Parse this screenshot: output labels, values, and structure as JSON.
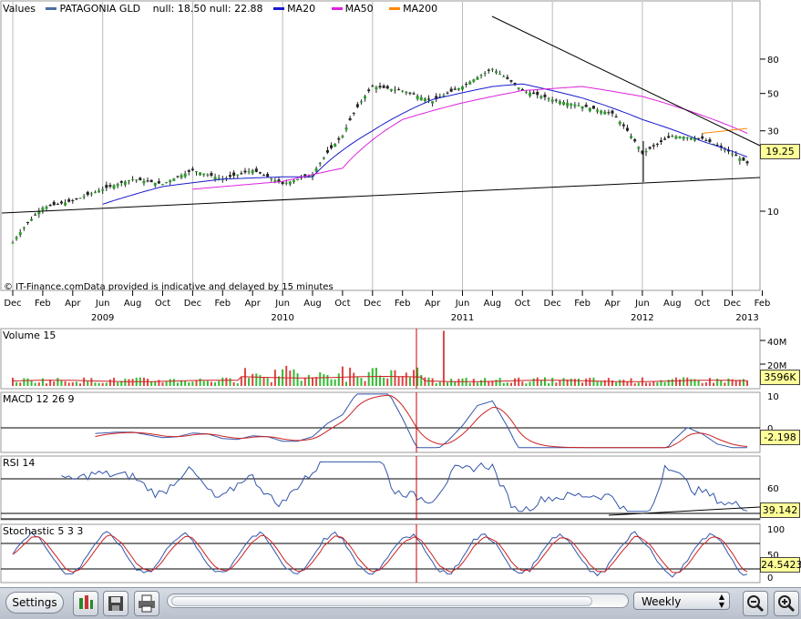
{
  "legend": {
    "values_label": "Values",
    "symbol": "PATAGONIA GLD",
    "null_info": "null: 18.50 null: 22.88",
    "ma20": "MA20",
    "ma50": "MA50",
    "ma200": "MA200",
    "colors": {
      "price": "#4a6fa5",
      "ma20": "#1a1acc",
      "ma50": "#dd22dd",
      "ma200": "#ff8800"
    }
  },
  "watermark": "© IT-Finance.comData provided is indicative and delayed by 15 minutes",
  "price_badge": "19.25",
  "x_axis": {
    "months": [
      "Dec",
      "Feb",
      "Apr",
      "Jun",
      "Aug",
      "Oct",
      "Dec",
      "Feb",
      "Apr",
      "Jun",
      "Aug",
      "Oct",
      "Dec",
      "Feb",
      "Apr",
      "Jun",
      "Aug",
      "Oct",
      "Dec",
      "Feb",
      "Apr",
      "Jun",
      "Aug",
      "Oct",
      "Dec",
      "Feb"
    ],
    "years": [
      "2009",
      "2010",
      "2011",
      "2012",
      "2013"
    ]
  },
  "volume_pane": {
    "label": "Volume 15",
    "ticks": [
      "40M",
      "20M"
    ],
    "badge": "3596K"
  },
  "macd_pane": {
    "label": "MACD 12 26 9",
    "ticks": [
      "10",
      "0"
    ],
    "badge": "-2.198"
  },
  "rsi_pane": {
    "label": "RSI 14",
    "ticks": [
      "60"
    ],
    "badge": "39.142"
  },
  "stoch_pane": {
    "label": "Stochastic 5 3 3",
    "ticks": [
      "100",
      "50",
      "0"
    ],
    "badge": "24.5423"
  },
  "toolbar": {
    "settings_label": "Settings",
    "period_label": "Weekly"
  },
  "chart_data": {
    "type": "candlestick",
    "title": "PATAGONIA GLD",
    "y_scale": "log",
    "y_ticks": [
      10,
      30,
      50,
      80
    ],
    "ylim": [
      5,
      85
    ],
    "x_range": [
      "Dec 2008",
      "Feb 2013"
    ],
    "series": [
      {
        "name": "Close",
        "dates": [
          "2008-12",
          "2009-02",
          "2009-04",
          "2009-06",
          "2009-08",
          "2009-10",
          "2009-12",
          "2010-02",
          "2010-04",
          "2010-06",
          "2010-08",
          "2010-10",
          "2010-12",
          "2011-02",
          "2011-04",
          "2011-06",
          "2011-08",
          "2011-10",
          "2011-12",
          "2012-02",
          "2012-04",
          "2012-06",
          "2012-08",
          "2012-10",
          "2012-12",
          "2013-01"
        ],
        "values": [
          6.5,
          10.5,
          11.5,
          13.5,
          15.5,
          14.5,
          17.5,
          15.5,
          17.5,
          14.5,
          16.5,
          28,
          55,
          52,
          45,
          55,
          70,
          52,
          46,
          42,
          38,
          22,
          28,
          27,
          22,
          19.25
        ]
      },
      {
        "name": "MA20",
        "dates": [
          "2009-06",
          "2009-10",
          "2010-02",
          "2010-06",
          "2010-08",
          "2010-12",
          "2011-04",
          "2011-08",
          "2011-10",
          "2012-02",
          "2012-06",
          "2012-10",
          "2013-01"
        ],
        "values": [
          11,
          14,
          15.5,
          16,
          16,
          30,
          46,
          55,
          57,
          47,
          35,
          26,
          21
        ]
      },
      {
        "name": "MA50",
        "dates": [
          "2009-12",
          "2010-06",
          "2010-10",
          "2011-02",
          "2011-06",
          "2011-10",
          "2012-02",
          "2012-06",
          "2012-10",
          "2013-01"
        ],
        "values": [
          13.5,
          15,
          18,
          35,
          44,
          52,
          55,
          48,
          37,
          29
        ]
      },
      {
        "name": "MA200",
        "dates": [
          "2012-10",
          "2013-01"
        ],
        "values": [
          29,
          31
        ]
      }
    ],
    "volume": {
      "label": "Volume 15",
      "last": "3596K",
      "ylim_millions": [
        0,
        45
      ]
    },
    "macd": {
      "label": "MACD 12 26 9",
      "last": -2.198,
      "ylim": [
        -3,
        11
      ]
    },
    "rsi": {
      "label": "RSI 14",
      "last": 39.142
    },
    "stochastic": {
      "label": "Stochastic 5 3 3",
      "last": 24.5423
    }
  }
}
